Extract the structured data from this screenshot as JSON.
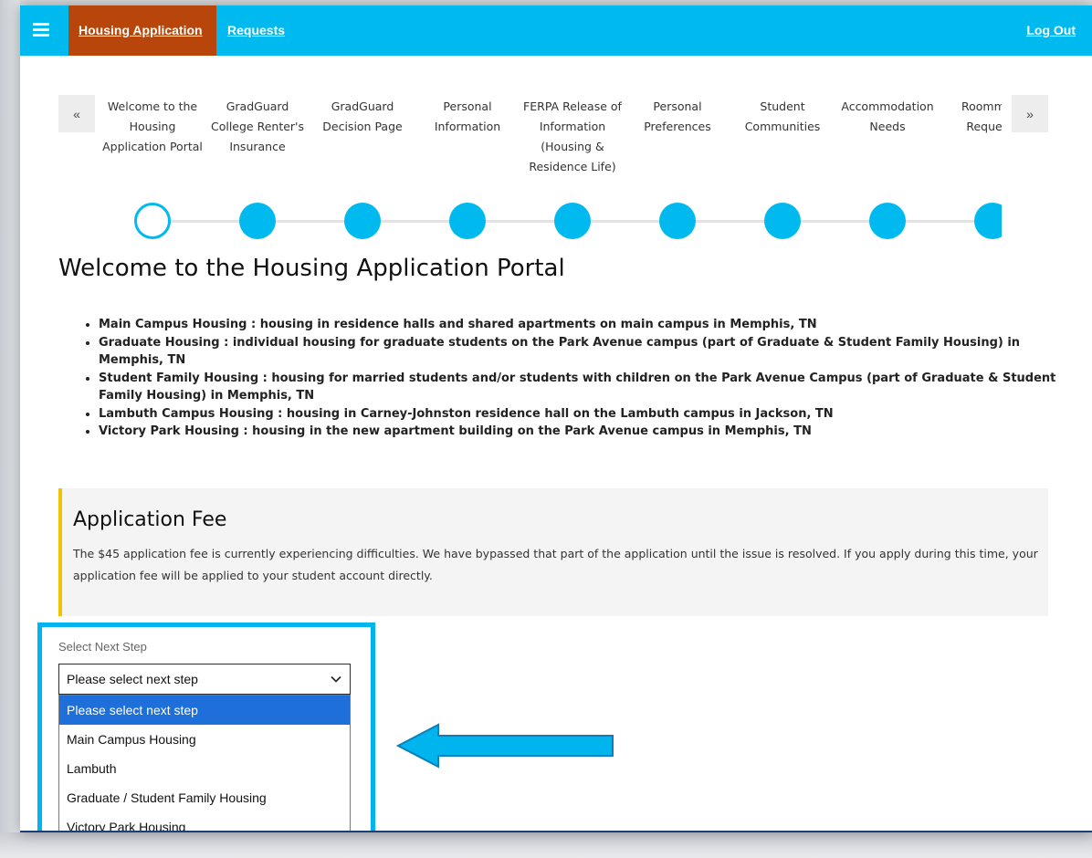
{
  "topbar": {
    "nav_active_label": "Housing Application",
    "nav_requests_label": "Requests",
    "logout_label": "Log Out",
    "accent_color": "#00b9ee",
    "active_tab_color": "#b8460a"
  },
  "stepper": {
    "prev_label": "«",
    "next_label": "»",
    "steps": [
      {
        "label": "Welcome to the Housing Application Portal",
        "status": "current"
      },
      {
        "label": "GradGuard College Renter's Insurance",
        "status": "upcoming"
      },
      {
        "label": "GradGuard Decision Page",
        "status": "upcoming"
      },
      {
        "label": "Personal Information",
        "status": "upcoming"
      },
      {
        "label": "FERPA Release of Information (Housing & Residence Life)",
        "status": "upcoming"
      },
      {
        "label": "Personal Preferences",
        "status": "upcoming"
      },
      {
        "label": "Student Communities",
        "status": "upcoming"
      },
      {
        "label": "Accommodation Needs",
        "status": "upcoming"
      },
      {
        "label": "Roommate Requests",
        "status": "upcoming"
      }
    ]
  },
  "main": {
    "title": "Welcome to the Housing Application Portal",
    "housing_options": [
      "Main Campus Housing : housing in residence halls and shared apartments on main campus in Memphis, TN",
      "Graduate Housing : individual housing for graduate students on the Park Avenue campus (part of Graduate & Student Family Housing) in Memphis, TN",
      "Student Family Housing : housing for married students and/or students with children on the Park Avenue Campus (part of Graduate & Student Family Housing) in Memphis, TN",
      "Lambuth Campus Housing : housing in Carney-Johnston residence hall on the Lambuth campus in Jackson, TN",
      "Victory Park Housing : housing in the new apartment building on the Park Avenue campus in Memphis, TN"
    ]
  },
  "fee_notice": {
    "title": "Application Fee",
    "text": "The $45 application fee is currently experiencing difficulties. We have bypassed that part of the application until the issue is resolved. If you apply during this time, your application fee will be applied to your student account directly.",
    "accent_color": "#f2c300"
  },
  "next_step": {
    "label": "Select Next Step",
    "selected_value": "Please select next step",
    "options": [
      "Please select next step",
      "Main Campus Housing",
      "Lambuth",
      "Graduate / Student Family Housing",
      "Victory Park Housing"
    ],
    "highlight_color": "#00b4ee"
  }
}
